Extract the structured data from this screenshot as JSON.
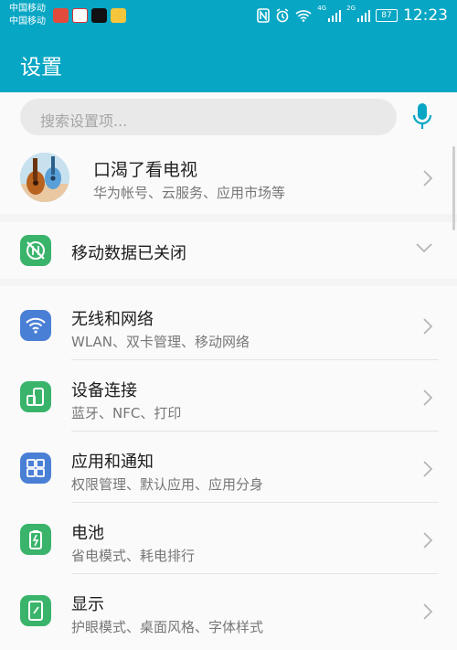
{
  "status_bar": {
    "carrier_1": "中国移动",
    "carrier_2": "中国移动",
    "network_1": "4G",
    "network_2": "2G",
    "battery": "87",
    "time": "12:23",
    "app_icons": [
      "toutiao-app-icon",
      "bank-app-icon",
      "tiktok-app-icon",
      "weibo-app-icon"
    ]
  },
  "header": {
    "title": "设置"
  },
  "search": {
    "placeholder": "搜索设置项..."
  },
  "account": {
    "name": "口渴了看电视",
    "subtitle": "华为帐号、云服务、应用市场等"
  },
  "mobile_data": {
    "label": "移动数据已关闭"
  },
  "settings": [
    {
      "title": "无线和网络",
      "subtitle": "WLAN、双卡管理、移动网络",
      "icon": "wifi-icon",
      "color": "#4a7fd6"
    },
    {
      "title": "设备连接",
      "subtitle": "蓝牙、NFC、打印",
      "icon": "device-connection-icon",
      "color": "#3ab46b"
    },
    {
      "title": "应用和通知",
      "subtitle": "权限管理、默认应用、应用分身",
      "icon": "apps-grid-icon",
      "color": "#4a7fd6"
    },
    {
      "title": "电池",
      "subtitle": "省电模式、耗电排行",
      "icon": "battery-icon",
      "color": "#3ab46b"
    },
    {
      "title": "显示",
      "subtitle": "护眼模式、桌面风格、字体样式",
      "icon": "display-icon",
      "color": "#3ab46b"
    }
  ],
  "colors": {
    "header": "#06a6c4",
    "accent": "#06a6c4",
    "icon_blue": "#4a7fd6",
    "icon_green": "#3ab46b"
  }
}
